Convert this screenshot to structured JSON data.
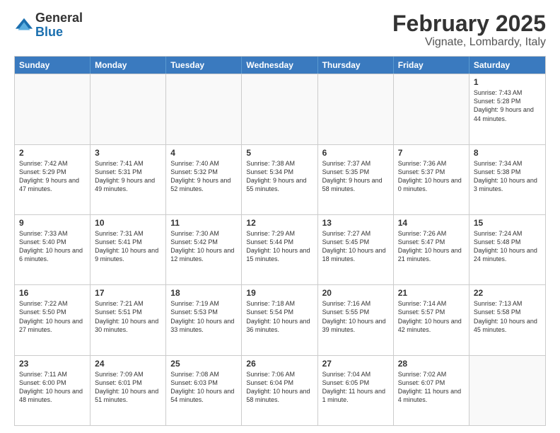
{
  "logo": {
    "general": "General",
    "blue": "Blue"
  },
  "title": "February 2025",
  "subtitle": "Vignate, Lombardy, Italy",
  "header_days": [
    "Sunday",
    "Monday",
    "Tuesday",
    "Wednesday",
    "Thursday",
    "Friday",
    "Saturday"
  ],
  "weeks": [
    [
      {
        "day": "",
        "text": ""
      },
      {
        "day": "",
        "text": ""
      },
      {
        "day": "",
        "text": ""
      },
      {
        "day": "",
        "text": ""
      },
      {
        "day": "",
        "text": ""
      },
      {
        "day": "",
        "text": ""
      },
      {
        "day": "1",
        "text": "Sunrise: 7:43 AM\nSunset: 5:28 PM\nDaylight: 9 hours and 44 minutes."
      }
    ],
    [
      {
        "day": "2",
        "text": "Sunrise: 7:42 AM\nSunset: 5:29 PM\nDaylight: 9 hours and 47 minutes."
      },
      {
        "day": "3",
        "text": "Sunrise: 7:41 AM\nSunset: 5:31 PM\nDaylight: 9 hours and 49 minutes."
      },
      {
        "day": "4",
        "text": "Sunrise: 7:40 AM\nSunset: 5:32 PM\nDaylight: 9 hours and 52 minutes."
      },
      {
        "day": "5",
        "text": "Sunrise: 7:38 AM\nSunset: 5:34 PM\nDaylight: 9 hours and 55 minutes."
      },
      {
        "day": "6",
        "text": "Sunrise: 7:37 AM\nSunset: 5:35 PM\nDaylight: 9 hours and 58 minutes."
      },
      {
        "day": "7",
        "text": "Sunrise: 7:36 AM\nSunset: 5:37 PM\nDaylight: 10 hours and 0 minutes."
      },
      {
        "day": "8",
        "text": "Sunrise: 7:34 AM\nSunset: 5:38 PM\nDaylight: 10 hours and 3 minutes."
      }
    ],
    [
      {
        "day": "9",
        "text": "Sunrise: 7:33 AM\nSunset: 5:40 PM\nDaylight: 10 hours and 6 minutes."
      },
      {
        "day": "10",
        "text": "Sunrise: 7:31 AM\nSunset: 5:41 PM\nDaylight: 10 hours and 9 minutes."
      },
      {
        "day": "11",
        "text": "Sunrise: 7:30 AM\nSunset: 5:42 PM\nDaylight: 10 hours and 12 minutes."
      },
      {
        "day": "12",
        "text": "Sunrise: 7:29 AM\nSunset: 5:44 PM\nDaylight: 10 hours and 15 minutes."
      },
      {
        "day": "13",
        "text": "Sunrise: 7:27 AM\nSunset: 5:45 PM\nDaylight: 10 hours and 18 minutes."
      },
      {
        "day": "14",
        "text": "Sunrise: 7:26 AM\nSunset: 5:47 PM\nDaylight: 10 hours and 21 minutes."
      },
      {
        "day": "15",
        "text": "Sunrise: 7:24 AM\nSunset: 5:48 PM\nDaylight: 10 hours and 24 minutes."
      }
    ],
    [
      {
        "day": "16",
        "text": "Sunrise: 7:22 AM\nSunset: 5:50 PM\nDaylight: 10 hours and 27 minutes."
      },
      {
        "day": "17",
        "text": "Sunrise: 7:21 AM\nSunset: 5:51 PM\nDaylight: 10 hours and 30 minutes."
      },
      {
        "day": "18",
        "text": "Sunrise: 7:19 AM\nSunset: 5:53 PM\nDaylight: 10 hours and 33 minutes."
      },
      {
        "day": "19",
        "text": "Sunrise: 7:18 AM\nSunset: 5:54 PM\nDaylight: 10 hours and 36 minutes."
      },
      {
        "day": "20",
        "text": "Sunrise: 7:16 AM\nSunset: 5:55 PM\nDaylight: 10 hours and 39 minutes."
      },
      {
        "day": "21",
        "text": "Sunrise: 7:14 AM\nSunset: 5:57 PM\nDaylight: 10 hours and 42 minutes."
      },
      {
        "day": "22",
        "text": "Sunrise: 7:13 AM\nSunset: 5:58 PM\nDaylight: 10 hours and 45 minutes."
      }
    ],
    [
      {
        "day": "23",
        "text": "Sunrise: 7:11 AM\nSunset: 6:00 PM\nDaylight: 10 hours and 48 minutes."
      },
      {
        "day": "24",
        "text": "Sunrise: 7:09 AM\nSunset: 6:01 PM\nDaylight: 10 hours and 51 minutes."
      },
      {
        "day": "25",
        "text": "Sunrise: 7:08 AM\nSunset: 6:03 PM\nDaylight: 10 hours and 54 minutes."
      },
      {
        "day": "26",
        "text": "Sunrise: 7:06 AM\nSunset: 6:04 PM\nDaylight: 10 hours and 58 minutes."
      },
      {
        "day": "27",
        "text": "Sunrise: 7:04 AM\nSunset: 6:05 PM\nDaylight: 11 hours and 1 minute."
      },
      {
        "day": "28",
        "text": "Sunrise: 7:02 AM\nSunset: 6:07 PM\nDaylight: 11 hours and 4 minutes."
      },
      {
        "day": "",
        "text": ""
      }
    ]
  ]
}
